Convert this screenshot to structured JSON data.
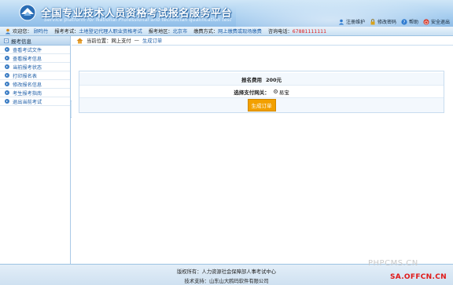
{
  "header": {
    "title": "全国专业技术人员资格考试报名服务平台",
    "subtitle": "Service platform for National Professional and technician qualification test",
    "tools": [
      {
        "label": "注册维护",
        "icon": "user-edit-icon"
      },
      {
        "label": "修改密码",
        "icon": "lock-icon"
      },
      {
        "label": "帮助",
        "icon": "help-icon"
      },
      {
        "label": "安全退出",
        "icon": "power-icon"
      }
    ]
  },
  "infobar": {
    "welcome_label": "欢迎您：",
    "welcome_user": "顾鸣竹",
    "exam_label": "报考考试：",
    "exam_value": "土地登记代理人职业资格考试",
    "region_label": "报考地区：",
    "region_value": "北京市",
    "fee_mode_label": "缴费方式：",
    "fee_mode_value": "网上缴费或现场缴费",
    "phone_label": "咨询电话：",
    "phone_value": "67881111111"
  },
  "sidebar": {
    "header": "报考信息",
    "items": [
      {
        "label": "查看考试文件"
      },
      {
        "label": "查看报考信息"
      },
      {
        "label": "当前报考状态"
      },
      {
        "label": "打印报名表"
      },
      {
        "label": "修改报名信息"
      },
      {
        "label": "考生报考指南"
      },
      {
        "label": "退出当前考试"
      }
    ]
  },
  "breadcrumb": {
    "label": "当前位置：网上支付",
    "separator": "—",
    "current": "生成订单"
  },
  "order": {
    "fee_label": "报名费用",
    "fee_value": "200元",
    "gateway_label": "选择支付网关：",
    "gateway_option": "易宝",
    "submit_label": "生成订单"
  },
  "footer": {
    "copyright": "版权所有：人力资源社会保障部人事考试中心",
    "support": "技术支持：山东山大鸥玛软件有限公司"
  },
  "watermark": {
    "line1": "PHPCMS.CN",
    "line2": "SA.OFFCN.CN"
  }
}
